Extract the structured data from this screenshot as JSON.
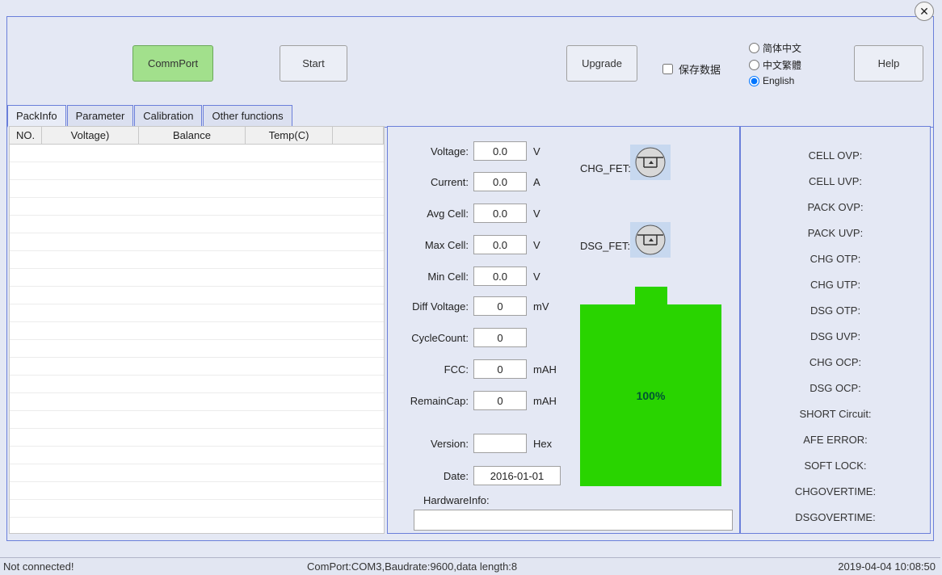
{
  "toolbar": {
    "commport_label": "CommPort",
    "start_label": "Start",
    "upgrade_label": "Upgrade",
    "help_label": "Help",
    "savedata_label": "保存数据"
  },
  "languages": {
    "simplified": "简体中文",
    "traditional": "中文繁體",
    "english": "English",
    "selected": "english"
  },
  "tabs": {
    "packinfo": "PackInfo",
    "parameter": "Parameter",
    "calibration": "Calibration",
    "other": "Other functions",
    "active": "packinfo"
  },
  "left_table": {
    "headers": {
      "no": "NO.",
      "voltage": "Voltage)",
      "balance": "Balance",
      "temp": "Temp(C)"
    }
  },
  "info": {
    "voltage": {
      "label": "Voltage:",
      "value": "0.0",
      "unit": "V"
    },
    "current": {
      "label": "Current:",
      "value": "0.0",
      "unit": "A"
    },
    "avg_cell": {
      "label": "Avg Cell:",
      "value": "0.0",
      "unit": "V"
    },
    "max_cell": {
      "label": "Max Cell:",
      "value": "0.0",
      "unit": "V"
    },
    "min_cell": {
      "label": "Min Cell:",
      "value": "0.0",
      "unit": "V"
    },
    "diff_voltage": {
      "label": "Diff Voltage:",
      "value": "0",
      "unit": "mV"
    },
    "cycle_count": {
      "label": "CycleCount:",
      "value": "0",
      "unit": ""
    },
    "fcc": {
      "label": "FCC:",
      "value": "0",
      "unit": "mAH"
    },
    "remain_cap": {
      "label": "RemainCap:",
      "value": "0",
      "unit": "mAH"
    },
    "version": {
      "label": "Version:",
      "value": "",
      "unit": "Hex"
    },
    "date": {
      "label": "Date:",
      "value": "2016-01-01",
      "unit": ""
    },
    "chg_fet_label": "CHG_FET:",
    "dsg_fet_label": "DSG_FET:",
    "battery_percent": "100%",
    "hardware_info_label": "HardwareInfo:",
    "hardware_info_value": ""
  },
  "alarms": [
    "CELL OVP:",
    "CELL UVP:",
    "PACK OVP:",
    "PACK UVP:",
    "CHG OTP:",
    "CHG UTP:",
    "DSG OTP:",
    "DSG UVP:",
    "CHG OCP:",
    "DSG OCP:",
    "SHORT Circuit:",
    "AFE ERROR:",
    "SOFT LOCK:",
    "CHGOVERTIME:",
    "DSGOVERTIME:"
  ],
  "status": {
    "connection": "Not connected!",
    "comport": "ComPort:COM3,Baudrate:9600,data length:8",
    "datetime": "2019-04-04 10:08:50"
  },
  "close_icon": "✕"
}
